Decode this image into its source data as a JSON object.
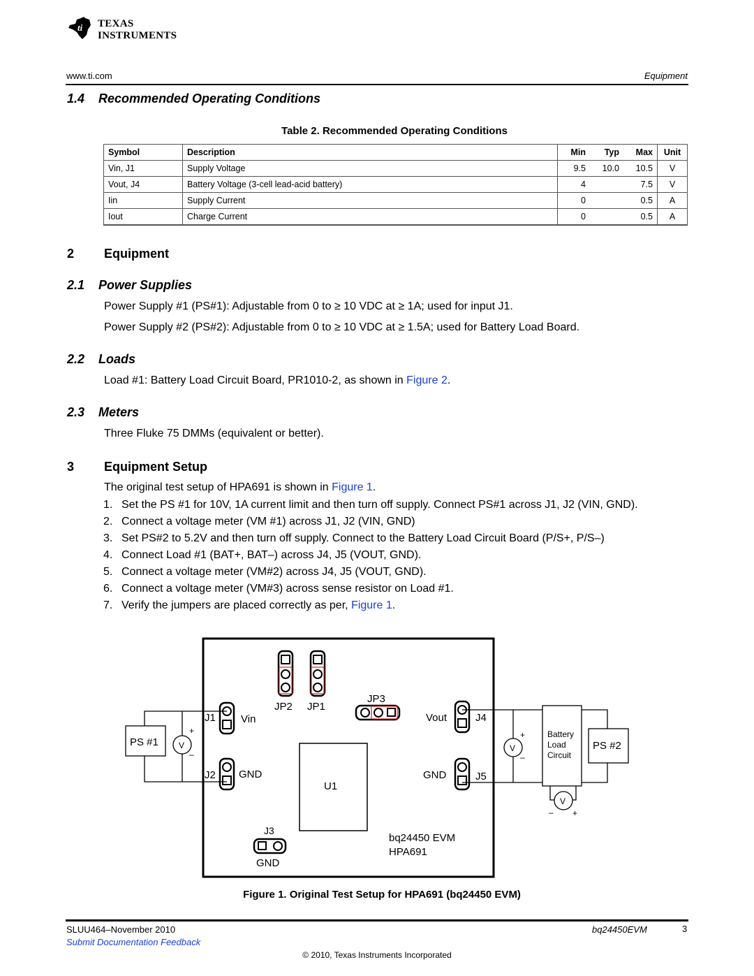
{
  "header": {
    "logo_line1": "Texas",
    "logo_line2": "Instruments",
    "website": "www.ti.com",
    "section_label": "Equipment"
  },
  "section_1_4": {
    "heading": "1.4    Recommended Operating Conditions",
    "table_caption": "Table 2. Recommended Operating Conditions",
    "columns": [
      "Symbol",
      "Description",
      "Min",
      "Typ",
      "Max",
      "Unit"
    ],
    "rows": [
      {
        "symbol": "Vin, J1",
        "description": "Supply Voltage",
        "min": "9.5",
        "typ": "10.0",
        "max": "10.5",
        "unit": "V"
      },
      {
        "symbol": "Vout, J4",
        "description": "Battery Voltage (3-cell lead-acid battery)",
        "min": "4",
        "typ": "",
        "max": "7.5",
        "unit": "V"
      },
      {
        "symbol": "Iin",
        "description": "Supply Current",
        "min": "0",
        "typ": "",
        "max": "0.5",
        "unit": "A"
      },
      {
        "symbol": "Iout",
        "description": "Charge Current",
        "min": "0",
        "typ": "",
        "max": "0.5",
        "unit": "A"
      }
    ]
  },
  "section_2": {
    "number": "2",
    "heading": "Equipment",
    "sub_2_1": {
      "heading": "2.1    Power Supplies",
      "p1": "Power Supply #1 (PS#1): Adjustable from 0 to ≥ 10 VDC at ≥ 1A; used for input J1.",
      "p2": "Power Supply #2 (PS#2): Adjustable from 0 to ≥ 10 VDC at ≥ 1.5A; used for Battery Load Board."
    },
    "sub_2_2": {
      "heading": "2.2    Loads",
      "text_before": "Load #1: Battery Load Circuit Board, PR1010-2, as shown in ",
      "link": "Figure 2",
      "text_after": "."
    },
    "sub_2_3": {
      "heading": "2.3    Meters",
      "p1": "Three Fluke 75 DMMs (equivalent or better)."
    }
  },
  "section_3": {
    "number": "3",
    "heading": "Equipment Setup",
    "intro_before": "The original test setup of HPA691 is shown in ",
    "intro_link": "Figure 1",
    "intro_after": ".",
    "steps": [
      {
        "n": "1.",
        "text": "Set the PS #1 for 10V, 1A current limit and then turn off supply. Connect PS#1 across J1, J2 (VIN, GND)."
      },
      {
        "n": "2.",
        "text": "Connect a voltage meter (VM #1) across J1, J2 (VIN, GND)"
      },
      {
        "n": "3.",
        "text": "Set PS#2 to 5.2V and then turn off supply. Connect to the Battery Load Circuit Board (P/S+, P/S–)"
      },
      {
        "n": "4.",
        "text": "Connect Load #1 (BAT+, BAT–) across J4, J5 (VOUT, GND)."
      },
      {
        "n": "5.",
        "text": "Connect a voltage meter (VM#2) across J4, J5 (VOUT, GND)."
      },
      {
        "n": "6.",
        "text": "Connect a voltage meter (VM#3) across sense resistor on Load #1."
      },
      {
        "n": "7.",
        "text": "Verify the jumpers are placed correctly as per, ",
        "link": "Figure 1",
        "after": "."
      }
    ]
  },
  "figure": {
    "labels": {
      "jp2": "JP2",
      "jp1": "JP1",
      "jp3": "JP3",
      "j1": "J1",
      "vin": "Vin",
      "j2": "J2",
      "gnd_left": "GND",
      "vout": "Vout",
      "j4": "J4",
      "gnd_right": "GND",
      "j5": "J5",
      "u1": "U1",
      "j3": "J3",
      "gnd_j3": "GND",
      "board_line1": "bq24450 EVM",
      "board_line2": "HPA691",
      "ps1": "PS #1",
      "ps2": "PS #2",
      "meter": "V",
      "plus": "+",
      "minus": "–",
      "battery_line1": "Battery",
      "battery_line2": "Load",
      "battery_line3": "Circuit"
    },
    "caption": "Figure 1. Original Test Setup for HPA691 (bq24450 EVM)",
    "jumper_highlight_color": "#e02020"
  },
  "footer": {
    "doc_id": "SLUU464–November 2010",
    "product": "bq24450EVM",
    "page_number": "3",
    "feedback_link": "Submit Documentation Feedback",
    "copyright": "© 2010, Texas Instruments Incorporated"
  }
}
